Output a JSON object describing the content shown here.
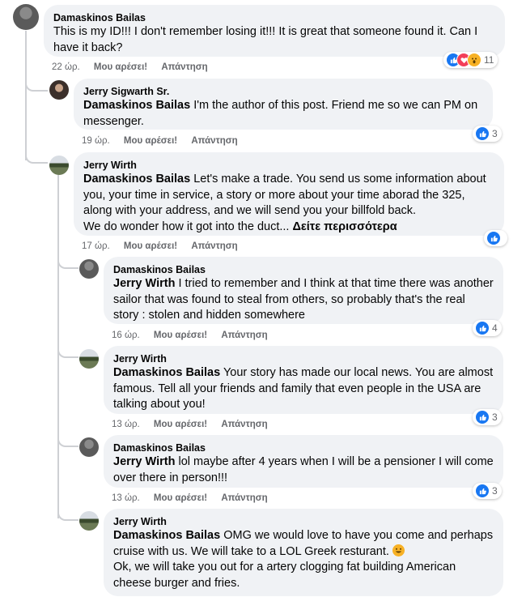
{
  "colors": {
    "bubble": "#f0f2f5",
    "meta": "#65676b",
    "like_blue": "#1877f2",
    "love_red": "#f33e58",
    "wow_yellow": "#f7b125",
    "thread_line": "#ced0d4"
  },
  "comments": [
    {
      "author": "Damaskinos Bailas",
      "mention": "",
      "text": "This is my ID!!! I don't remember losing it!!! It is great that someone found it. Can I have it back?",
      "time": "22 ώρ.",
      "like_label": "Μου αρέσει!",
      "reply_label": "Απάντηση",
      "reactions": [
        "like-icon",
        "love-icon",
        "wow-icon"
      ],
      "reaction_count": "11"
    },
    {
      "author": "Jerry Sigwarth Sr.",
      "mention": "Damaskinos Bailas",
      "text": " I'm the author of this post. Friend me so we can PM on messenger.",
      "time": "19 ώρ.",
      "like_label": "Μου αρέσει!",
      "reply_label": "Απάντηση",
      "reactions": [
        "like-icon"
      ],
      "reaction_count": "3"
    },
    {
      "author": "Jerry Wirth",
      "mention": "Damaskinos Bailas",
      "text": " Let's make a trade. You send us some information about you, your time in service, a story or more about your time aborad the 325, along with your address, and we will send you your billfold back.",
      "text2": "We do wonder how it got into the duct...",
      "see_more": "Δείτε περισσότερα",
      "time": "17 ώρ.",
      "like_label": "Μου αρέσει!",
      "reply_label": "Απάντηση",
      "reactions": [
        "like-icon"
      ],
      "reaction_count": ""
    },
    {
      "author": "Damaskinos Bailas",
      "mention": "Jerry Wirth",
      "text": " I tried to remember and I think at that time there was another sailor that was found to steal from others, so probably that's the real story : stolen and hidden somewhere",
      "time": "16 ώρ.",
      "like_label": "Μου αρέσει!",
      "reply_label": "Απάντηση",
      "reactions": [
        "like-icon"
      ],
      "reaction_count": "4"
    },
    {
      "author": "Jerry Wirth",
      "mention": "Damaskinos Bailas",
      "text": " Your story has made our local news. You are almost famous. Tell all your friends and family that even people in the USA are talking about you!",
      "time": "13 ώρ.",
      "like_label": "Μου αρέσει!",
      "reply_label": "Απάντηση",
      "reactions": [
        "like-icon"
      ],
      "reaction_count": "3"
    },
    {
      "author": "Damaskinos Bailas",
      "mention": "Jerry Wirth",
      "text": " lol maybe after 4 years when I will be a pensioner I will come over there in person!!!",
      "time": "13 ώρ.",
      "like_label": "Μου αρέσει!",
      "reply_label": "Απάντηση",
      "reactions": [
        "like-icon"
      ],
      "reaction_count": "3"
    },
    {
      "author": "Jerry Wirth",
      "mention": "Damaskinos Bailas",
      "text": " OMG we would love to have you come and perhaps cruise with us. We will take to a LOL Greek resturant.",
      "emoji": "grinning-face-emoji",
      "text2": "Ok, we will take you out for a artery clogging fat building American cheese burger and fries."
    }
  ]
}
